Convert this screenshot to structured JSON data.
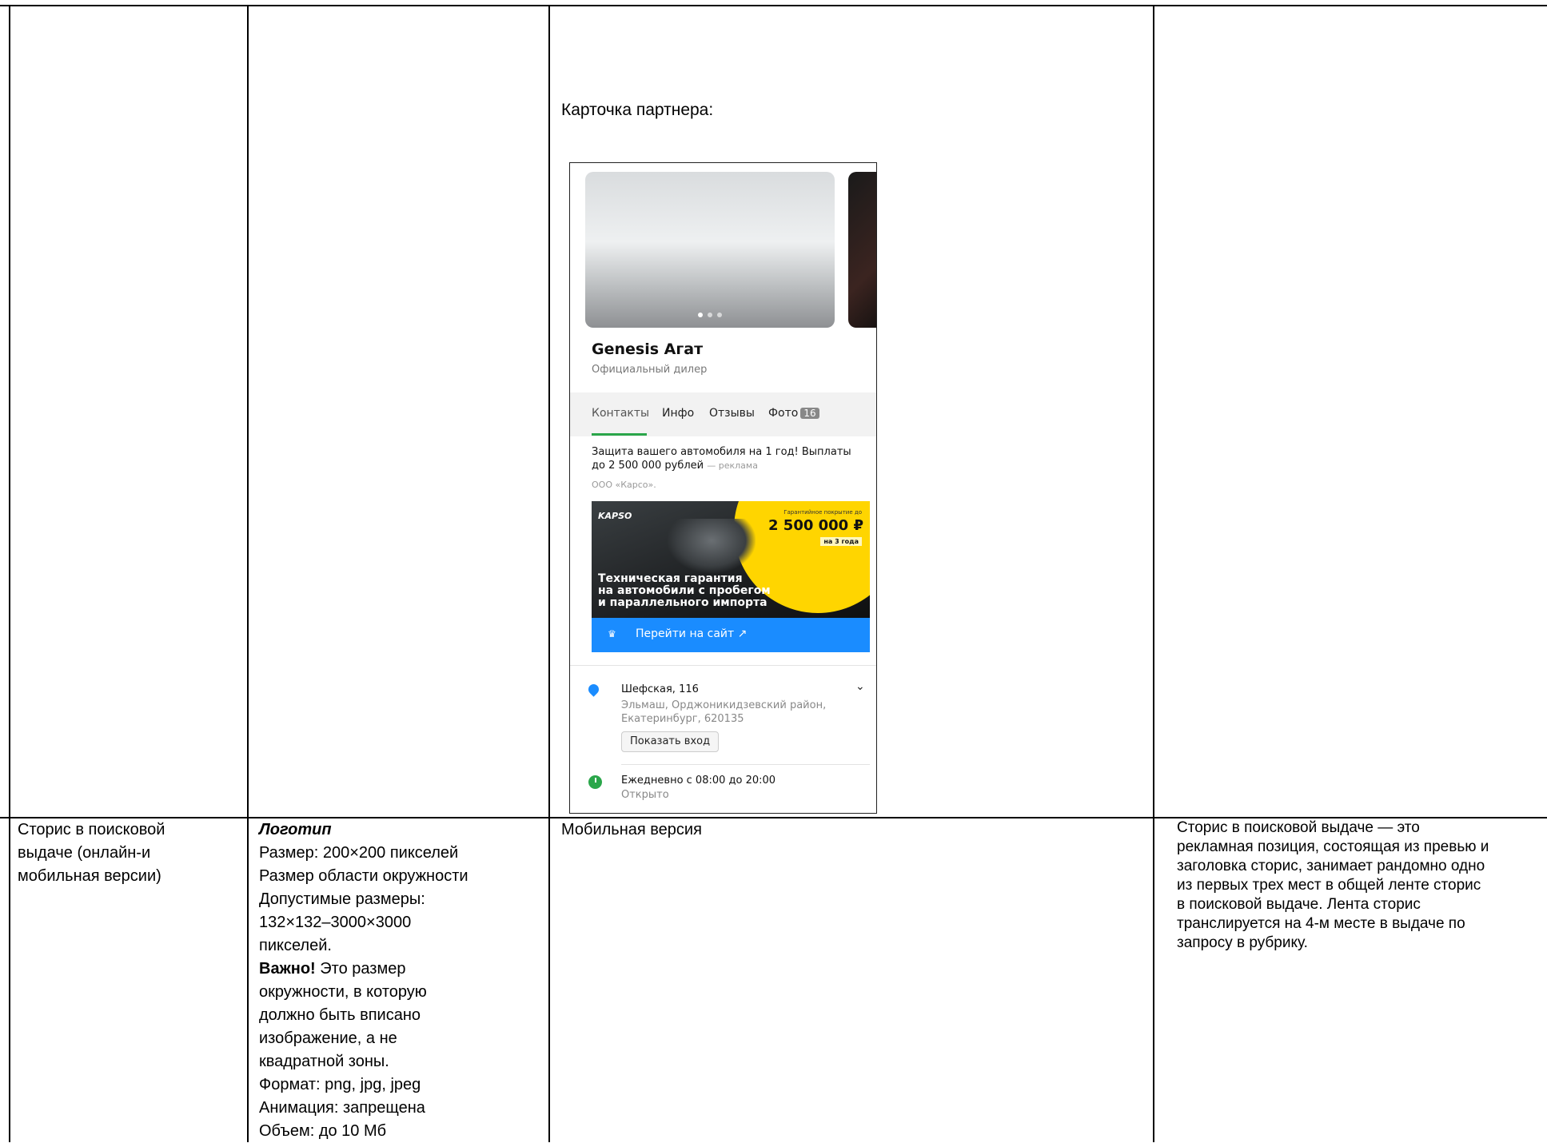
{
  "top_row": {
    "caption": "Карточка партнера:"
  },
  "partner_card": {
    "name": "Genesis Агат",
    "subtitle": "Официальный дилер",
    "tabs": [
      "Контакты",
      "Инфо",
      "Отзывы",
      "Фото"
    ],
    "photo_count": "16",
    "ad": {
      "text": "Защита вашего автомобиля на 1 год! Выплаты до 2 500 000 рублей",
      "mark": "— реклама",
      "org": "ООО «Карсо».",
      "banner_logo": "KAPSO",
      "banner_coverage_label": "Гарантийное покрытие до",
      "banner_amount": "2 500 000 ₽",
      "banner_years": "на 3 года",
      "banner_headline_1": "Техническая гарантия",
      "banner_headline_2": "на автомобили с пробегом",
      "banner_headline_3": "и параллельного импорта",
      "button": "Перейти на сайт ↗"
    },
    "address": {
      "street": "Шефская, 116",
      "line2": "Эльмаш, Орджоникидзевский район,",
      "line3": "Екатеринбург, 620135",
      "entry_button": "Показать вход"
    },
    "hours": {
      "schedule": "Ежедневно с 08:00 до 20:00",
      "status": "Открыто"
    }
  },
  "bottom_row": {
    "col1": [
      "Сторис в поисковой",
      "выдаче (онлайн-и",
      "мобильная версии)"
    ],
    "col2": {
      "logo_title": "Логотип",
      "lines": [
        "Размер: 200×200 пикселей",
        "Размер области окружности",
        "Допустимые размеры:",
        "132×132–3000×3000",
        "пикселей."
      ],
      "important_label": "Важно!",
      "important_rest": " Это размер",
      "lines2": [
        "окружности, в которую",
        "должно быть вписано",
        "изображение, а не",
        "квадратной зоны.",
        "Формат: png, jpg, jpeg",
        "Анимация: запрещена",
        "Объем: до 10 Мб"
      ]
    },
    "col3": "Мобильная версия",
    "col4": [
      "Сторис в поисковой выдаче — это",
      "рекламная позиция, состоящая из превью и",
      "заголовка сторис, занимает рандомно одно",
      "из первых трех мест в общей ленте сторис",
      "в поисковой выдаче. Лента сторис",
      "транслируется на 4-м месте в выдаче по",
      "запросу в рубрику."
    ]
  }
}
